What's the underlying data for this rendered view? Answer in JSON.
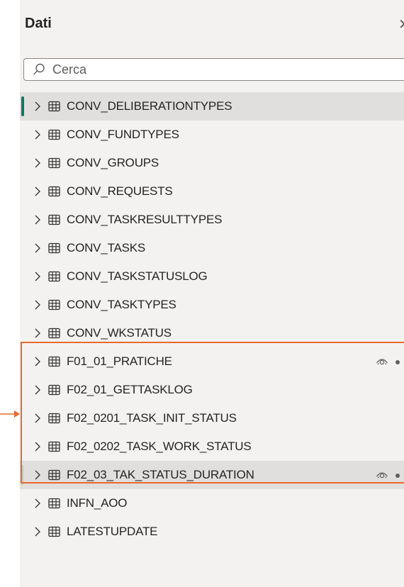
{
  "panel": {
    "title": "Dati",
    "close_glyph": "✕"
  },
  "search": {
    "placeholder": "Cerca"
  },
  "tables": [
    {
      "label": "CONV_DELIBERATIONTYPES",
      "state": "selected",
      "hidden_icon": false
    },
    {
      "label": "CONV_FUNDTYPES",
      "state": "",
      "hidden_icon": false
    },
    {
      "label": "CONV_GROUPS",
      "state": "",
      "hidden_icon": false
    },
    {
      "label": "CONV_REQUESTS",
      "state": "",
      "hidden_icon": false
    },
    {
      "label": "CONV_TASKRESULTTYPES",
      "state": "",
      "hidden_icon": false
    },
    {
      "label": "CONV_TASKS",
      "state": "",
      "hidden_icon": false
    },
    {
      "label": "CONV_TASKSTATUSLOG",
      "state": "",
      "hidden_icon": false
    },
    {
      "label": "CONV_TASKTYPES",
      "state": "",
      "hidden_icon": false
    },
    {
      "label": "CONV_WKSTATUS",
      "state": "",
      "hidden_icon": false
    },
    {
      "label": "F01_01_PRATICHE",
      "state": "",
      "hidden_icon": true
    },
    {
      "label": "F02_01_GETTASKLOG",
      "state": "",
      "hidden_icon": false
    },
    {
      "label": "F02_0201_TASK_INIT_STATUS",
      "state": "",
      "hidden_icon": false
    },
    {
      "label": "F02_0202_TASK_WORK_STATUS",
      "state": "",
      "hidden_icon": false
    },
    {
      "label": "F02_03_TAK_STATUS_DURATION",
      "state": "hovered",
      "hidden_icon": true
    },
    {
      "label": "INFN_AOO",
      "state": "",
      "hidden_icon": false
    },
    {
      "label": "LATESTUPDATE",
      "state": "",
      "hidden_icon": false
    }
  ],
  "annotation": {
    "color": "#e86a2a"
  },
  "colors": {
    "accent": "#117865",
    "panel_bg": "#f3f2f1"
  }
}
